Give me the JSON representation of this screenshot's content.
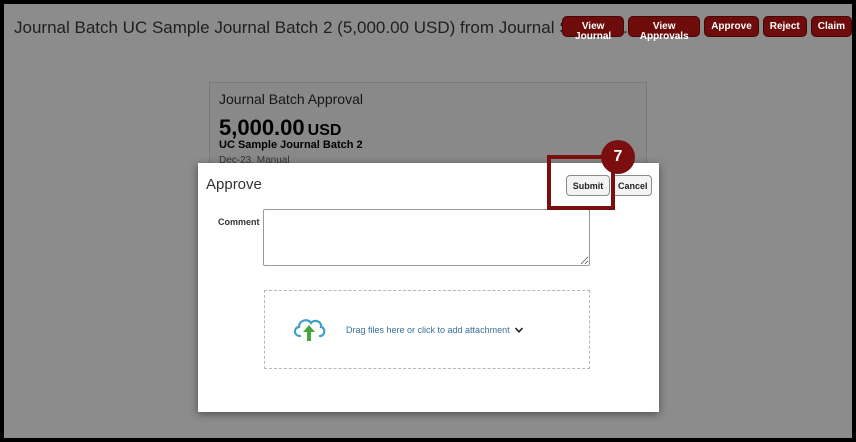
{
  "header": {
    "title": "Journal Batch UC Sample Journal Batch 2 (5,000.00 USD) from Journal Submitt…",
    "actions": {
      "view_journal": "View Journal",
      "view_approvals": "View Approvals",
      "approve": "Approve",
      "reject": "Reject",
      "claim": "Claim"
    }
  },
  "summary_card": {
    "heading": "Journal Batch Approval",
    "amount": "5,000.00",
    "currency": "USD",
    "batch_name": "UC Sample Journal Batch 2",
    "subtitle": "Dec-23, Manual"
  },
  "dialog": {
    "title": "Approve",
    "submit_label": "Submit",
    "cancel_label": "Cancel",
    "comment_label": "Comment",
    "comment_value": "",
    "attachment_text": "Drag files here or click to add attachment"
  },
  "callout": {
    "step_number": "7"
  },
  "icons": {
    "upload": "cloud-upload-icon",
    "chevron": "chevron-down-icon"
  },
  "colors": {
    "accent": "#6e0b0b",
    "upload_cloud": "#3aa0c4",
    "upload_arrow": "#45a63c",
    "link_text": "#3a6f9b"
  }
}
